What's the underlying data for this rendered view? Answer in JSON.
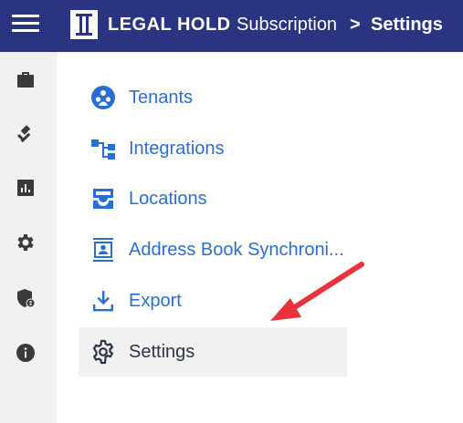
{
  "header": {
    "brand": "LEGAL HOLD",
    "breadcrumb": [
      "Subscription",
      ">",
      "Settings"
    ]
  },
  "sidebar": {
    "icons": [
      "briefcase-icon",
      "gavel-icon",
      "chart-icon",
      "gear-icon",
      "shield-user-icon",
      "info-icon"
    ]
  },
  "menu": {
    "items": [
      {
        "label": "Tenants",
        "icon": "tenants-icon"
      },
      {
        "label": "Integrations",
        "icon": "integrations-icon"
      },
      {
        "label": "Locations",
        "icon": "locations-icon"
      },
      {
        "label": "Address Book Synchroni...",
        "icon": "address-book-icon"
      },
      {
        "label": "Export",
        "icon": "export-icon"
      },
      {
        "label": "Settings",
        "icon": "gear-icon",
        "active": true
      }
    ]
  },
  "colors": {
    "header_bg": "#2b3481",
    "link": "#2a6fd0",
    "sidebar_icon": "#3a3a3a",
    "active_bg": "#f1f1f1",
    "annotation_arrow": "#e8323c"
  }
}
